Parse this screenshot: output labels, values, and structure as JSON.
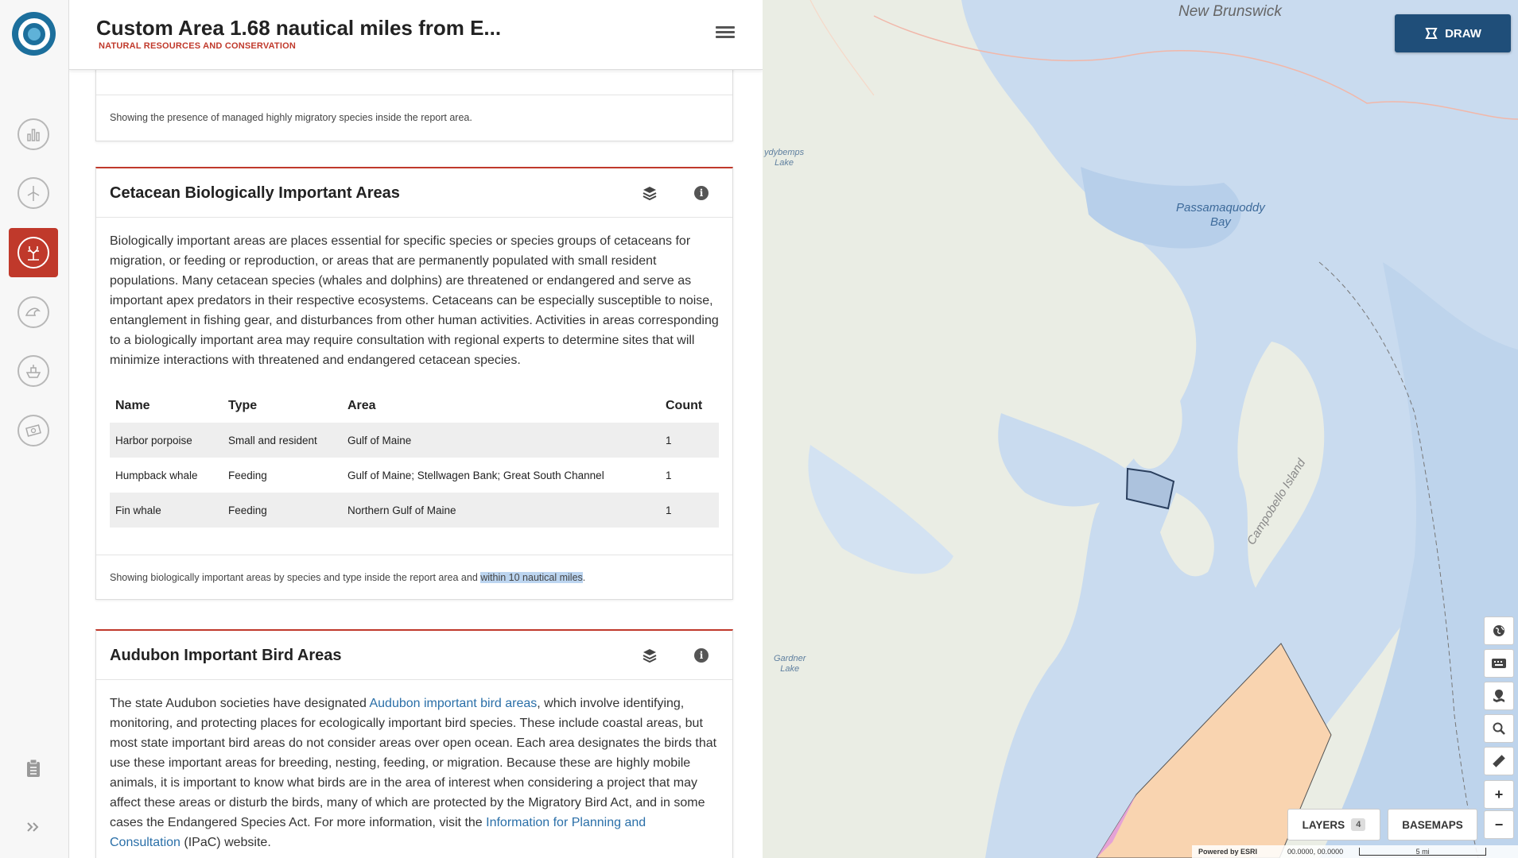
{
  "header": {
    "title": "Custom Area 1.68 nautical miles from E...",
    "subtitle": "NATURAL RESOURCES AND CONSERVATION"
  },
  "rail": {
    "items": [
      "chart-icon",
      "wind-turbine-icon",
      "coral-icon",
      "wave-icon",
      "ship-icon",
      "money-icon"
    ],
    "active": "coral-icon",
    "bottom": [
      "clipboard-icon",
      "expand-icon"
    ]
  },
  "prev_card": {
    "footer": "Showing the presence of managed highly migratory species inside the report area."
  },
  "cetacean": {
    "title": "Cetacean Biologically Important Areas",
    "description": "Biologically important areas are places essential for specific species or species groups of cetaceans for migration, or feeding or reproduction, or areas that are permanently populated with small resident populations. Many cetacean species (whales and dolphins) are threatened or endangered and serve as important apex predators in their respective ecosystems. Cetaceans can be especially susceptible to noise, entanglement in fishing gear, and disturbances from other human activities. Activities in areas corresponding to a biologically important area may require consultation with regional experts to determine sites that will minimize interactions with threatened and endangered cetacean species.",
    "columns": [
      "Name",
      "Type",
      "Area",
      "Count"
    ],
    "rows": [
      [
        "Harbor porpoise",
        "Small and resident",
        "Gulf of Maine",
        "1"
      ],
      [
        "Humpback whale",
        "Feeding",
        "Gulf of Maine; Stellwagen Bank; Great South Channel",
        "1"
      ],
      [
        "Fin whale",
        "Feeding",
        "Northern Gulf of Maine",
        "1"
      ]
    ],
    "footer_prefix": "Showing biologically important areas by species and type inside the report area and ",
    "footer_highlight": "within 10 nautical miles",
    "footer_suffix": "."
  },
  "audubon": {
    "title": "Audubon Important Bird Areas",
    "p1": "The state Audubon societies have designated ",
    "link1": "Audubon important bird areas",
    "p2": ", which involve identifying, monitoring, and protecting places for ecologically important bird species. These include coastal areas, but most state important bird areas do not consider areas over open ocean. Each area designates the birds that use these important areas for breeding, nesting, feeding, or migration. Because these are highly mobile animals, it is important to know what birds are in the area of interest when considering a project that may affect these areas or disturb the birds, many of which are protected by the Migratory Bird Act, and in some cases the Endangered Species Act. For more information, visit the ",
    "link2": "Information for Planning and Consultation",
    "p3": " (IPaC) website."
  },
  "map": {
    "labels": {
      "new_brunswick": "New Brunswick",
      "passamaquoddy": "Passamaquoddy\nBay",
      "campobello": "Campobello Island",
      "ydybemps": "ydybemps\nLake",
      "gardner": "Gardner\nLake"
    },
    "draw_label": "DRAW",
    "layers_label": "LAYERS",
    "layers_count": "4",
    "basemaps_label": "BASEMAPS",
    "powered_by": "Powered by ESRI",
    "coords": "00.0000, 00.0000",
    "scale": "5 mi",
    "tools": [
      "globe-icon",
      "keyboard-icon",
      "map-pin-icon",
      "search-icon",
      "ruler-icon",
      "zoom-in-icon",
      "zoom-out-icon"
    ],
    "zoom_in": "+",
    "zoom_out": "−",
    "colors": {
      "water": "#c9dbef",
      "land": "#eaede4",
      "wind_area": "#f9d4b0",
      "accent": "#1f4e79"
    }
  }
}
